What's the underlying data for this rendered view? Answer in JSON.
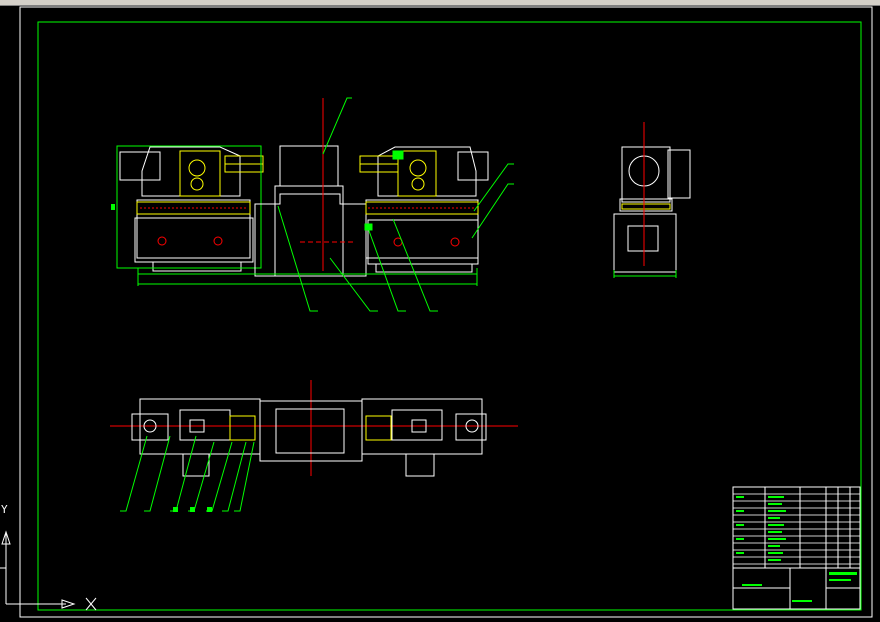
{
  "window": {
    "background": "#000000",
    "line_colors": {
      "frame": "#ffffff",
      "border": "#00ff00",
      "object": "#ffffff",
      "hidden": "#00ff00",
      "detail": "#ffff00",
      "center": "#ff0000"
    }
  },
  "toolbar": {
    "visible": true
  },
  "drawing": {
    "views": [
      "front-view",
      "side-view",
      "top-view"
    ],
    "leaders_front": [
      "1",
      "2",
      "3"
    ],
    "title_block": {
      "present": true
    }
  },
  "ucs": {
    "x_label": "X",
    "y_label": "Y"
  }
}
